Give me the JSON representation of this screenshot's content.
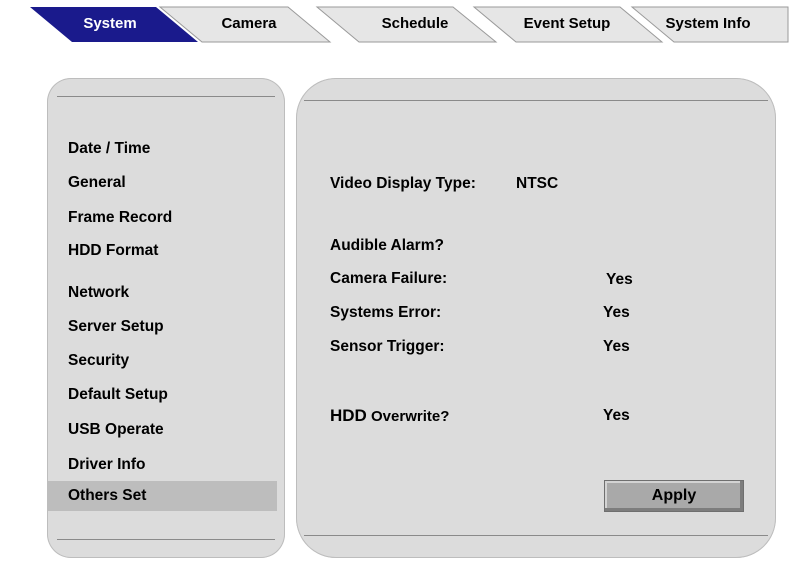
{
  "tabs": [
    {
      "label": "System",
      "active": true
    },
    {
      "label": "Camera",
      "active": false
    },
    {
      "label": "Schedule",
      "active": false
    },
    {
      "label": "Event Setup",
      "active": false
    },
    {
      "label": "System Info",
      "active": false
    }
  ],
  "colors": {
    "active_tab": "#1a1a8c",
    "inactive_tab": "#e6e6e6",
    "panel": "#dcdcdc",
    "selected_item": "#bdbdbd",
    "button": "#a9a9a9"
  },
  "sidebar": {
    "items": [
      {
        "label": "Date / Time"
      },
      {
        "label": "General"
      },
      {
        "label": "Frame Record"
      },
      {
        "label": "HDD Format"
      },
      {
        "label": "Network"
      },
      {
        "label": "Server Setup"
      },
      {
        "label": "Security"
      },
      {
        "label": "Default Setup"
      },
      {
        "label": "USB Operate"
      },
      {
        "label": "Driver Info"
      },
      {
        "label": "Others Set",
        "selected": true
      }
    ]
  },
  "main": {
    "video_display_label": "Video Display Type:",
    "video_display_value": "NTSC",
    "audible_alarm_label": "Audible Alarm?",
    "camera_failure_label": "Camera Failure:",
    "camera_failure_value": "Yes",
    "systems_error_label": "Systems Error:",
    "systems_error_value": "Yes",
    "sensor_trigger_label": "Sensor Trigger:",
    "sensor_trigger_value": "Yes",
    "hdd_overwrite_label_big": "HDD",
    "hdd_overwrite_label_rest": " Overwrite?",
    "hdd_overwrite_value": "Yes",
    "apply_label": "Apply"
  }
}
